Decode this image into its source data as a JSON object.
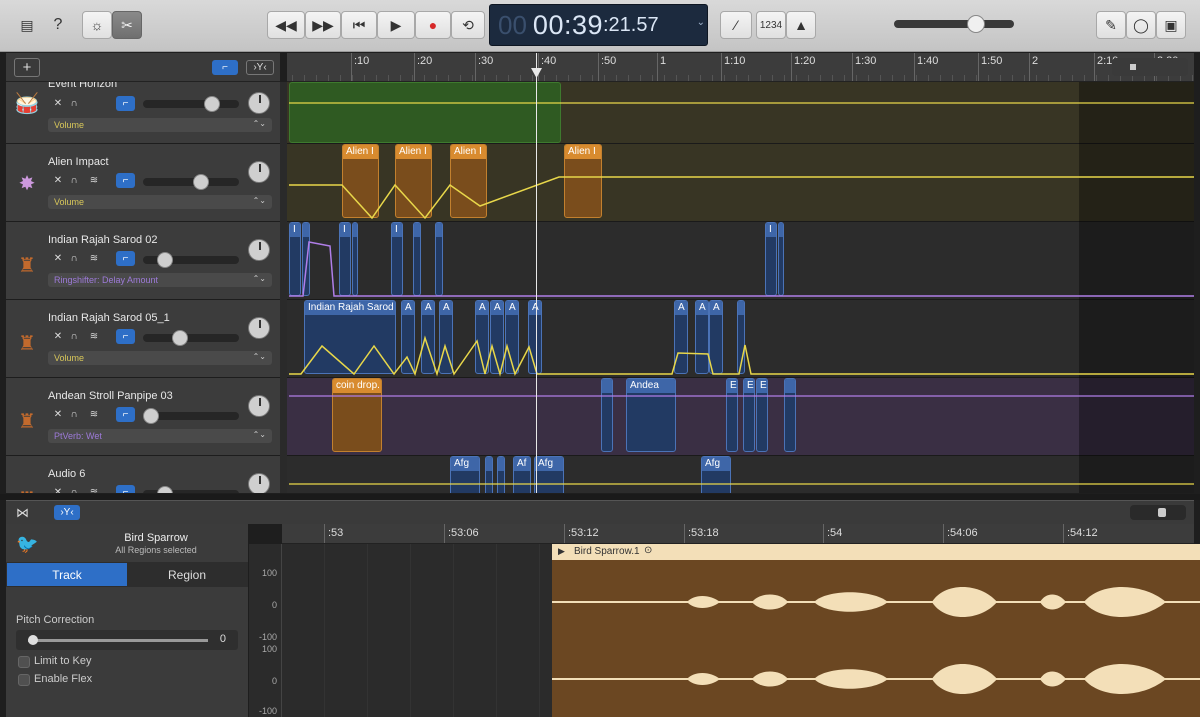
{
  "transport": {
    "time_bars_dim": "00",
    "time_main": "00:39",
    "time_frac": ":21.57",
    "counter": "1234"
  },
  "ruler": {
    "labels": [
      ":10",
      ":20",
      ":30",
      ":40",
      ":50",
      "1",
      "1:10",
      "1:20",
      "1:30",
      "1:40",
      "1:50",
      "2",
      "2:10",
      "2:20"
    ]
  },
  "tracks": [
    {
      "name": "Event Horizon",
      "param": "Volume",
      "param_color": "#d8c75a",
      "icon": "drum-kit-icon"
    },
    {
      "name": "Alien Impact",
      "param": "Volume",
      "param_color": "#d8c75a",
      "icon": "sparkle-icon"
    },
    {
      "name": "Indian Rajah Sarod 02",
      "param": "Ringshifter: Delay Amount",
      "param_color": "#9d7ad8",
      "icon": "sarod-icon"
    },
    {
      "name": "Indian Rajah Sarod 05_1",
      "param": "Volume",
      "param_color": "#d8c75a",
      "icon": "sarod-icon"
    },
    {
      "name": "Andean Stroll Panpipe 03",
      "param": "PtVerb: Wet",
      "param_color": "#9d7ad8",
      "icon": "sarod-icon"
    },
    {
      "name": "Audio 6",
      "param": "",
      "param_color": "#d8c75a",
      "icon": "sarod-icon"
    }
  ],
  "regions": {
    "alien1": "Alien I",
    "alien2": "Alien I",
    "alien3": "Alien I",
    "alien4": "Alien I",
    "sarod_i": "I",
    "sarod05": "Indian Rajah Sarod",
    "a": "A",
    "coin": "coin drop.",
    "andea": "Andea",
    "e": "E",
    "afg": "Afg",
    "af": "Af"
  },
  "editor": {
    "track_name": "Bird Sparrow",
    "subtitle": "All Regions selected",
    "tab_track": "Track",
    "tab_region": "Region",
    "pitch_label": "Pitch Correction",
    "pitch_value": "0",
    "limit_key": "Limit to Key",
    "enable_flex": "Enable Flex",
    "ruler_labels": [
      ":53",
      ":53:06",
      ":53:12",
      ":53:18",
      ":54",
      ":54:06",
      ":54:12"
    ],
    "region_name": "Bird Sparrow.1",
    "axis": [
      "100",
      "0",
      "-100",
      "100",
      "0",
      "-100"
    ]
  }
}
